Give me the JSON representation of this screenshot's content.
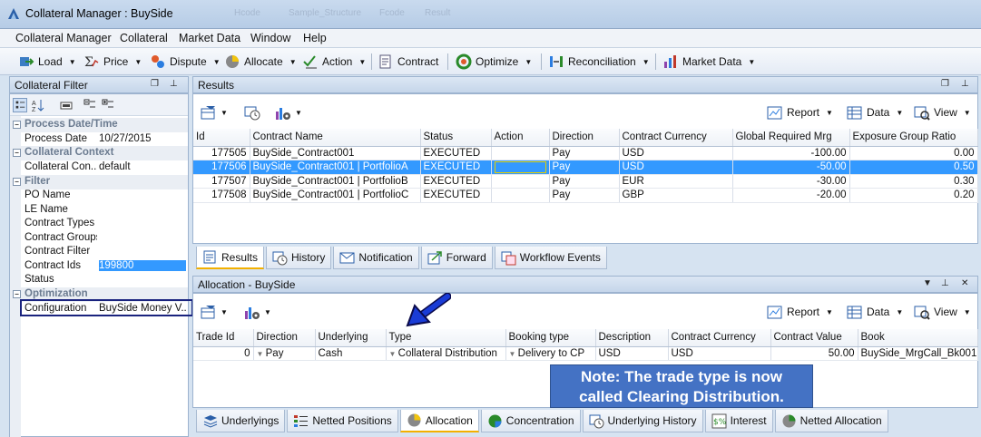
{
  "window": {
    "title": "Collateral Manager : BuySide",
    "ghost_tabs": [
      "Hcode",
      "Sample_Structure",
      "Fcode",
      "Result"
    ]
  },
  "menu": [
    "Collateral Manager",
    "Collateral",
    "Market Data",
    "Window",
    "Help"
  ],
  "toolbar": {
    "load": "Load",
    "price": "Price",
    "dispute": "Dispute",
    "allocate": "Allocate",
    "action": "Action",
    "contract": "Contract",
    "optimize": "Optimize",
    "reconciliation": "Reconciliation",
    "market_data": "Market Data"
  },
  "filter": {
    "header": "Collateral Filter",
    "cat_process": "Process Date/Time",
    "process_date_k": "Process Date",
    "process_date_v": "10/27/2015",
    "cat_context": "Collateral Context",
    "context_k": "Collateral Con...",
    "context_v": "default",
    "cat_filter": "Filter",
    "po_name": "PO Name",
    "le_name": "LE Name",
    "contract_types": "Contract Types",
    "contract_groups": "Contract Groups",
    "contract_filter": "Contract Filter",
    "contract_ids_k": "Contract Ids",
    "contract_ids_v": "199800",
    "status": "Status",
    "cat_opt": "Optimization",
    "config_k": "Configuration",
    "config_v": "BuySide Money V..."
  },
  "results": {
    "header": "Results",
    "report": "Report",
    "data": "Data",
    "view": "View",
    "columns": [
      "Id",
      "Contract Name",
      "Status",
      "Action",
      "Direction",
      "Contract Currency",
      "Global Required Mrg",
      "Exposure Group Ratio"
    ],
    "rows": [
      {
        "id": "177505",
        "name": "BuySide_Contract001",
        "status": "EXECUTED",
        "action": "",
        "direction": "Pay",
        "ccy": "USD",
        "mrg": "-100.00",
        "ratio": "0.00"
      },
      {
        "id": "177506",
        "name": "BuySide_Contract001 | PortfolioA",
        "status": "EXECUTED",
        "action": "",
        "direction": "Pay",
        "ccy": "USD",
        "mrg": "-50.00",
        "ratio": "0.50"
      },
      {
        "id": "177507",
        "name": "BuySide_Contract001 | PortfolioB",
        "status": "EXECUTED",
        "action": "",
        "direction": "Pay",
        "ccy": "EUR",
        "mrg": "-30.00",
        "ratio": "0.30"
      },
      {
        "id": "177508",
        "name": "BuySide_Contract001 | PortfolioC",
        "status": "EXECUTED",
        "action": "",
        "direction": "Pay",
        "ccy": "GBP",
        "mrg": "-20.00",
        "ratio": "0.20"
      }
    ],
    "tabs": [
      "Results",
      "History",
      "Notification",
      "Forward",
      "Workflow Events"
    ]
  },
  "allocation": {
    "header": "Allocation - BuySide",
    "report": "Report",
    "data": "Data",
    "view": "View",
    "columns": [
      "Trade Id",
      "Direction",
      "Underlying",
      "Type",
      "Booking type",
      "Description",
      "Contract Currency",
      "Contract Value",
      "Book"
    ],
    "row": {
      "trade_id": "0",
      "direction": "Pay",
      "underlying": "Cash",
      "type": "Collateral Distribution",
      "booking": "Delivery to CP",
      "description": "USD",
      "ccy": "USD",
      "value": "50.00",
      "book": "BuySide_MrgCall_Bk001"
    },
    "tabs": [
      "Underlyings",
      "Netted Positions",
      "Allocation",
      "Concentration",
      "Underlying History",
      "Interest",
      "Netted Allocation"
    ]
  },
  "note": {
    "line1": "Note: The trade type is now",
    "line2": "called Clearing Distribution."
  },
  "colors": {
    "selection": "#3399ff",
    "note_bg": "#4472c4",
    "accent_tab": "#f3b000"
  }
}
